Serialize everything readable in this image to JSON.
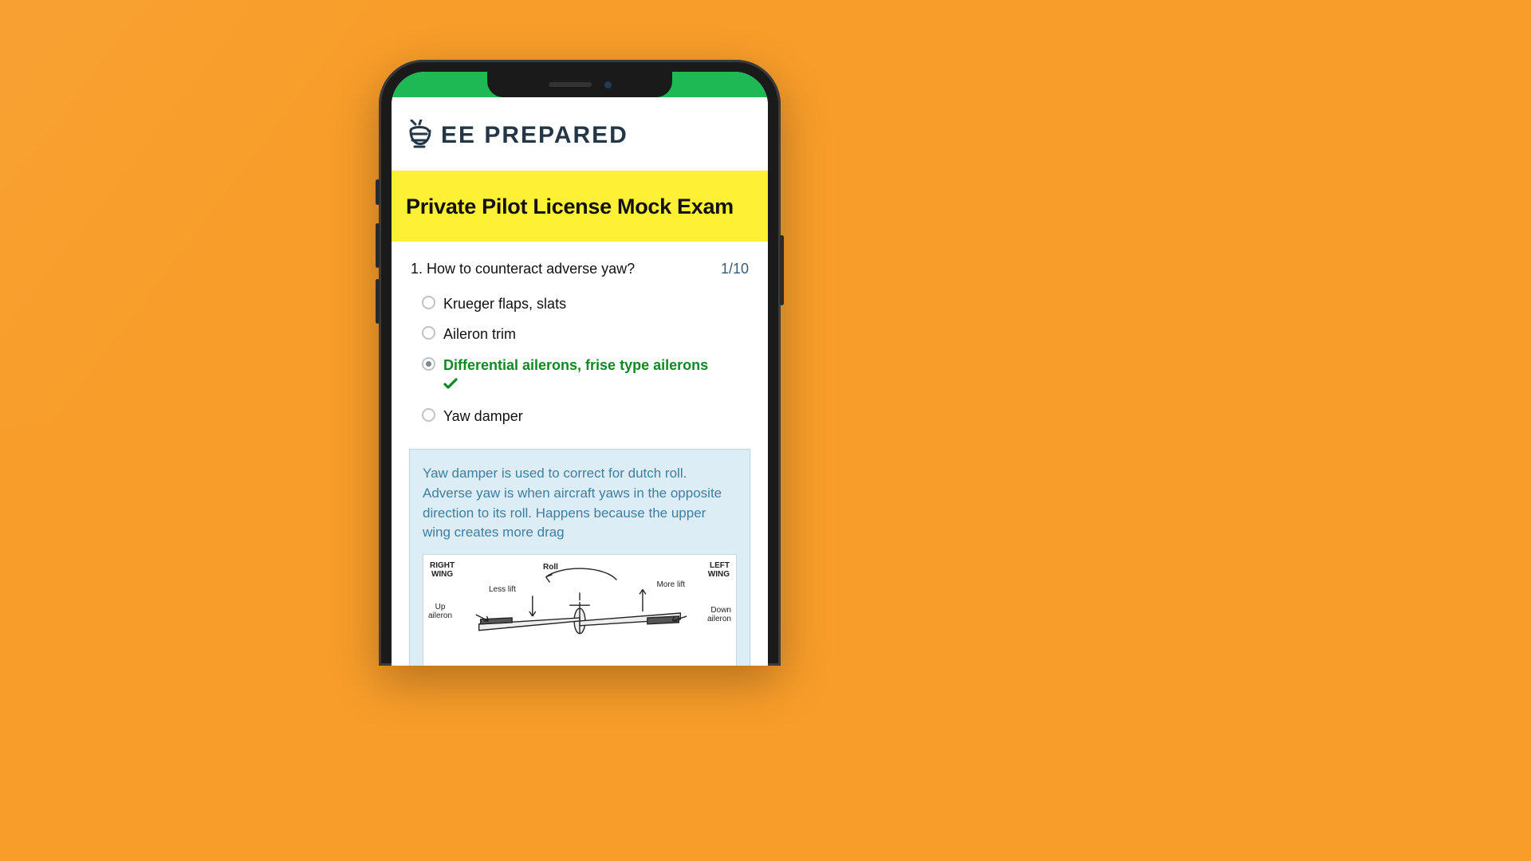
{
  "colors": {
    "background": "#f89d2a",
    "accent_green": "#1eb955",
    "title_band": "#fef035",
    "correct": "#0f8a23",
    "explain_bg": "#dcedf6",
    "explain_text": "#3e7ea0",
    "brand": "#253746"
  },
  "brand": {
    "name": "BEE PREPARED",
    "rest": "EE PREPARED"
  },
  "exam": {
    "title": "Private Pilot License Mock Exam",
    "question_number_prefix": "1. ",
    "question_text": "How to counteract adverse yaw?",
    "progress": "1/10",
    "options": [
      {
        "label": "Krueger flaps, slats",
        "selected": false,
        "correct": false
      },
      {
        "label": "Aileron trim",
        "selected": false,
        "correct": false
      },
      {
        "label": "Differential ailerons, frise type ailerons",
        "selected": true,
        "correct": true
      },
      {
        "label": "Yaw damper",
        "selected": false,
        "correct": false
      }
    ],
    "explanation": "Yaw damper is used to correct for dutch roll. Adverse yaw is when aircraft yaws in the opposite direction to its roll. Happens because the upper wing creates more drag"
  },
  "diagram": {
    "right_wing": "RIGHT WING",
    "left_wing": "LEFT WING",
    "roll": "Roll",
    "less_lift": "Less lift",
    "more_lift": "More lift",
    "up_aileron": "Up aileron",
    "down_aileron": "Down aileron"
  }
}
